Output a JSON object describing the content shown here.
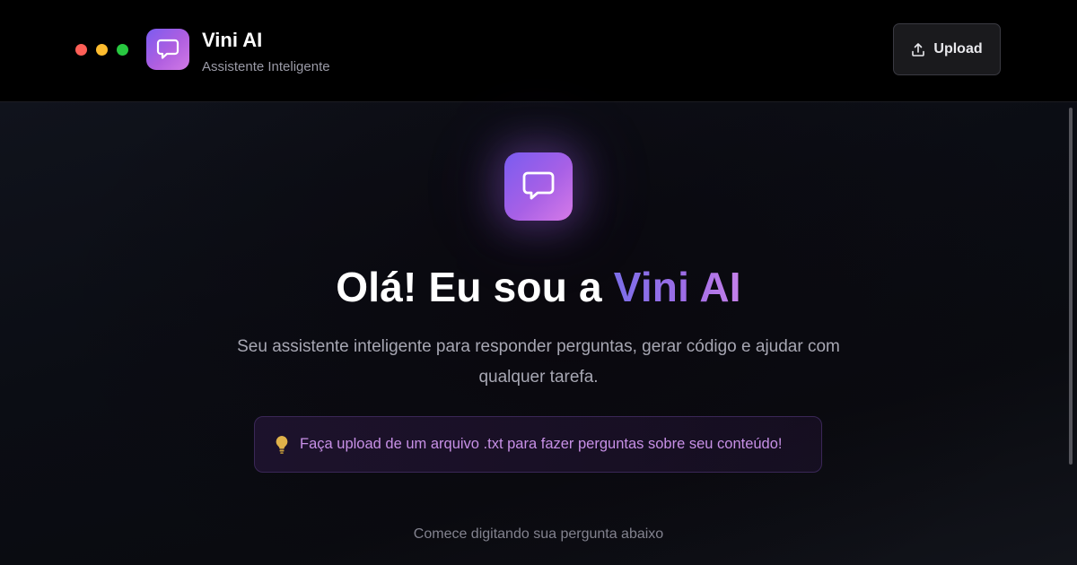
{
  "header": {
    "app_name": "Vini AI",
    "app_subtitle": "Assistente Inteligente",
    "upload_label": "Upload",
    "logo_icon": "chat-bubble-icon",
    "upload_icon": "upload-icon"
  },
  "hero": {
    "icon": "chat-bubble-icon",
    "headline_prefix": "Olá! Eu sou a ",
    "headline_accent": "Vini AI",
    "description": "Seu assistente inteligente para responder perguntas, gerar código e ajudar com qualquer tarefa.",
    "tip_icon": "lightbulb-icon",
    "tip_text": "Faça upload de um arquivo .txt para fazer perguntas sobre seu conteúdo!",
    "hint": "Comece digitando sua pergunta abaixo"
  },
  "colors": {
    "accent_gradient_start": "#7a5cf0",
    "accent_gradient_end": "#d67ae8",
    "tip_text": "#c790e6",
    "window_dot_red": "#ff5f57",
    "window_dot_yellow": "#febc2e",
    "window_dot_green": "#28c840"
  }
}
